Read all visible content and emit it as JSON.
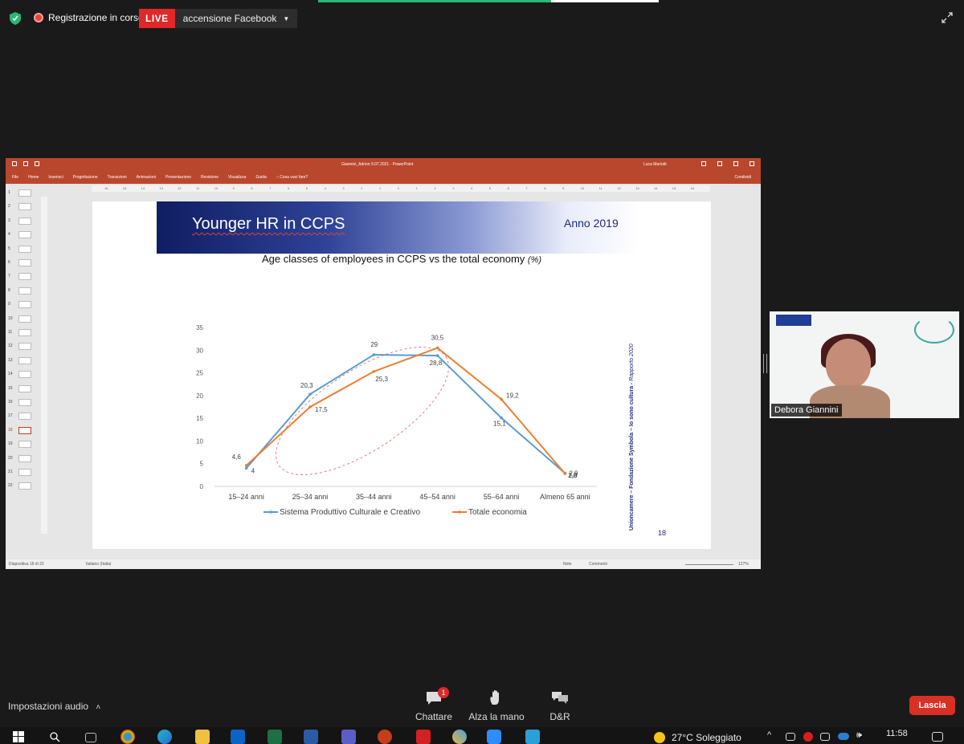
{
  "zoom_bar": {
    "recording_label": "Registrazione in corso",
    "live_label": "LIVE",
    "stream_label": "accensione Facebook"
  },
  "ppt": {
    "window_title": "Giannini_Adrion 9.07.2021 - PowerPoint",
    "user": "Luca Mariotti",
    "ribbon_tabs": [
      "File",
      "Home",
      "Inserisci",
      "Progettazione",
      "Transizioni",
      "Animazioni",
      "Presentazione",
      "Revisione",
      "Visualizza",
      "Guida"
    ],
    "tell_me": "Cosa vuoi fare?",
    "share": "Condividi",
    "ruler_ticks": [
      "16",
      "15",
      "14",
      "13",
      "12",
      "11",
      "10",
      "9",
      "8",
      "7",
      "6",
      "5",
      "4",
      "3",
      "2",
      "1",
      "0",
      "1",
      "2",
      "3",
      "4",
      "5",
      "6",
      "7",
      "8",
      "9",
      "10",
      "11",
      "12",
      "13",
      "14",
      "15",
      "16"
    ],
    "thumb_numbers": [
      "1",
      "2",
      "3",
      "4",
      "5",
      "6",
      "7",
      "8",
      "9",
      "10",
      "11",
      "12",
      "13",
      "14",
      "15",
      "16",
      "17",
      "18",
      "19",
      "20",
      "21",
      "22"
    ],
    "active_slide": "18",
    "status": {
      "slide_info": "Diapositiva 18 di 22",
      "language": "Italiano (Italia)",
      "notes": "Note",
      "comments": "Commenti",
      "zoom": "127%"
    }
  },
  "slide": {
    "title": "Younger HR in CCPS",
    "year": "Anno 2019",
    "subtitle": "Age classes of employees in CCPS vs the total economy",
    "subtitle_unit": "(%)",
    "source_main": "Unioncamere – Fondazione Symbola – Io sono cultura - ",
    "source_report": "Rapporto 2020",
    "page_number": "18"
  },
  "chart_data": {
    "type": "line",
    "categories": [
      "15–24 anni",
      "25–34 anni",
      "35–44 anni",
      "45–54 anni",
      "55–64 anni",
      "Almeno 65 anni"
    ],
    "series": [
      {
        "name": "Sistema Produttivo Culturale e Creativo",
        "values": [
          4,
          20.3,
          29,
          28.8,
          15.1,
          2.9
        ],
        "labels": [
          "4",
          "20,3",
          "29",
          "28,8",
          "15,1",
          "2,9"
        ],
        "color": "#5b9bd5"
      },
      {
        "name": "Totale economia",
        "values": [
          4.6,
          17.5,
          25.3,
          30.5,
          19.2,
          2.8
        ],
        "labels": [
          "4,6",
          "17,5",
          "25,3",
          "30,5",
          "19,2",
          "2,8"
        ],
        "color": "#ed7d31"
      }
    ],
    "y_ticks": [
      "0",
      "5",
      "10",
      "15",
      "20",
      "25",
      "30",
      "35"
    ],
    "ylim": [
      0,
      35
    ],
    "grid": false,
    "legend": "bottom",
    "highlight": "dashed red ellipse around 15–24 to 45–54 anni"
  },
  "participant": {
    "name": "Debora Giannini"
  },
  "controls": {
    "audio_settings": "Impostazioni audio",
    "chat": "Chattare",
    "chat_badge": "1",
    "raise_hand": "Alza la mano",
    "qa": "D&R",
    "leave": "Lascia"
  },
  "taskbar": {
    "weather": "27°C  Soleggiato",
    "time": "11:58"
  },
  "colors": {
    "ppt_accent": "#b8472d",
    "live_red": "#e02828",
    "leave_red": "#d93025",
    "slide_navy": "#1d2a7c"
  }
}
